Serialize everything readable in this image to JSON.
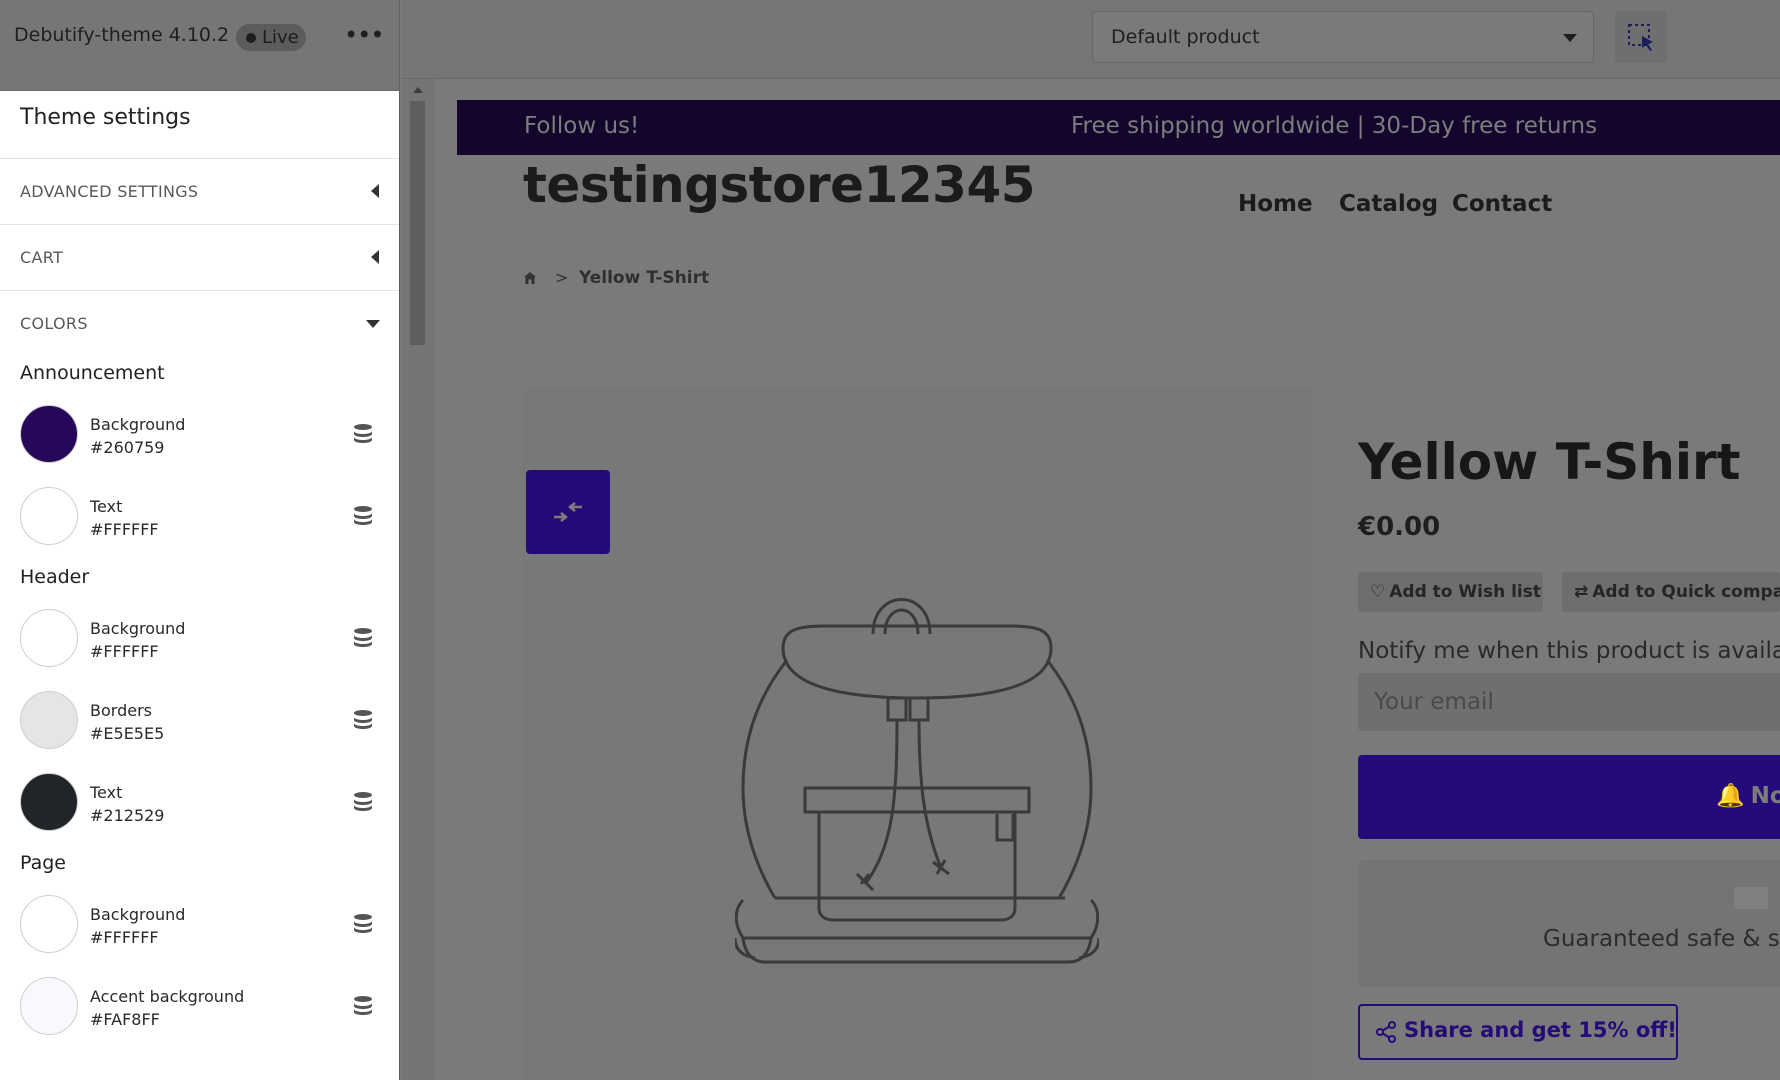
{
  "editor": {
    "theme_name": "Debutify-theme 4.10.2",
    "status_badge": "Live",
    "more_label": "•••"
  },
  "sidebar": {
    "heading": "Theme settings",
    "sections": [
      {
        "label": "ADVANCED SETTINGS",
        "expanded": false
      },
      {
        "label": "CART",
        "expanded": false
      },
      {
        "label": "COLORS",
        "expanded": true
      }
    ],
    "color_groups": [
      {
        "title": "Announcement",
        "swatches": [
          {
            "name": "Background",
            "hex": "#260759"
          },
          {
            "name": "Text",
            "hex": "#FFFFFF"
          }
        ]
      },
      {
        "title": "Header",
        "swatches": [
          {
            "name": "Background",
            "hex": "#FFFFFF"
          },
          {
            "name": "Borders",
            "hex": "#E5E5E5"
          },
          {
            "name": "Text",
            "hex": "#212529"
          }
        ]
      },
      {
        "title": "Page",
        "swatches": [
          {
            "name": "Background",
            "hex": "#FFFFFF"
          },
          {
            "name": "Accent background",
            "hex": "#FAF8FF"
          }
        ]
      }
    ]
  },
  "toolbar": {
    "variant_select_value": "Default product",
    "inspect_icon": "select-element-icon"
  },
  "store": {
    "announcement": {
      "left": "Follow us!",
      "center": "Free shipping worldwide | 30-Day free returns"
    },
    "title": "testingstore12345",
    "nav": [
      "Home",
      "Catalog",
      "Contact"
    ],
    "breadcrumb": {
      "separator": ">",
      "current": "Yellow T-Shirt"
    },
    "product": {
      "title": "Yellow T-Shirt",
      "price": "€0.00",
      "wishlist_label": "Add to Wish list",
      "compare_label": "Add to Quick compa",
      "notify_text": "Notify me when this product is availa",
      "email_placeholder": "Your email",
      "notify_button": "Notify",
      "guarantee_text": "Guaranteed safe & s",
      "share_button": "Share and get 15% off!"
    }
  },
  "colors": {
    "brand": "#260759",
    "overlay_gray": "#7a7a7a"
  }
}
